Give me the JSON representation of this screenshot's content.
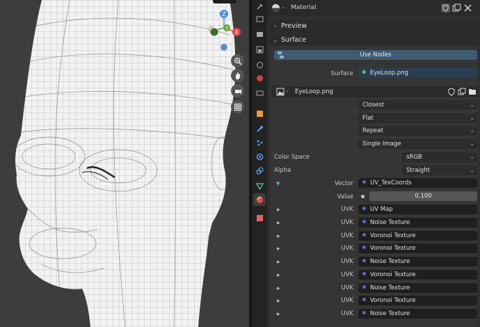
{
  "properties": {
    "header_title": "Material",
    "preview_label": "Preview",
    "surface_label": "Surface",
    "use_nodes_label": "Use Nodes",
    "surface_row": {
      "label": "Surface",
      "value": "EyeLoop.png"
    },
    "image_name": "EyeLoop.png",
    "interpolation": "Closest",
    "projection": "Flat",
    "extension": "Repeat",
    "source": "Single Image",
    "color_space": {
      "label": "Color Space",
      "value": "sRGB"
    },
    "alpha": {
      "label": "Alpha",
      "value": "Straight"
    },
    "vector": {
      "label": "Vector",
      "value": "UV_TexCoords"
    },
    "value_row": {
      "label": "Value",
      "value": "0.100"
    },
    "uvk_rows": [
      {
        "label": "UVK",
        "value": "UV Map"
      },
      {
        "label": "UVK",
        "value": "Noise Texture"
      },
      {
        "label": "UVK",
        "value": "Voronoi Texture"
      },
      {
        "label": "UVK",
        "value": "Voronoi Texture"
      },
      {
        "label": "UVK",
        "value": "Noise Texture"
      },
      {
        "label": "UVK",
        "value": "Voronoi Texture"
      },
      {
        "label": "UVK",
        "value": "Noise Texture"
      },
      {
        "label": "UVK",
        "value": "Voronoi Texture"
      },
      {
        "label": "UVK",
        "value": "Noise Texture"
      }
    ]
  },
  "gizmo": {
    "z": "Z",
    "y": "Y",
    "x": "X"
  },
  "colors": {
    "accent_blue": "#3f5b73",
    "socket_yellow": "#c7c729",
    "socket_purple": "#6363c7",
    "socket_gray": "#a1a1a1",
    "socket_green": "#63c763"
  }
}
